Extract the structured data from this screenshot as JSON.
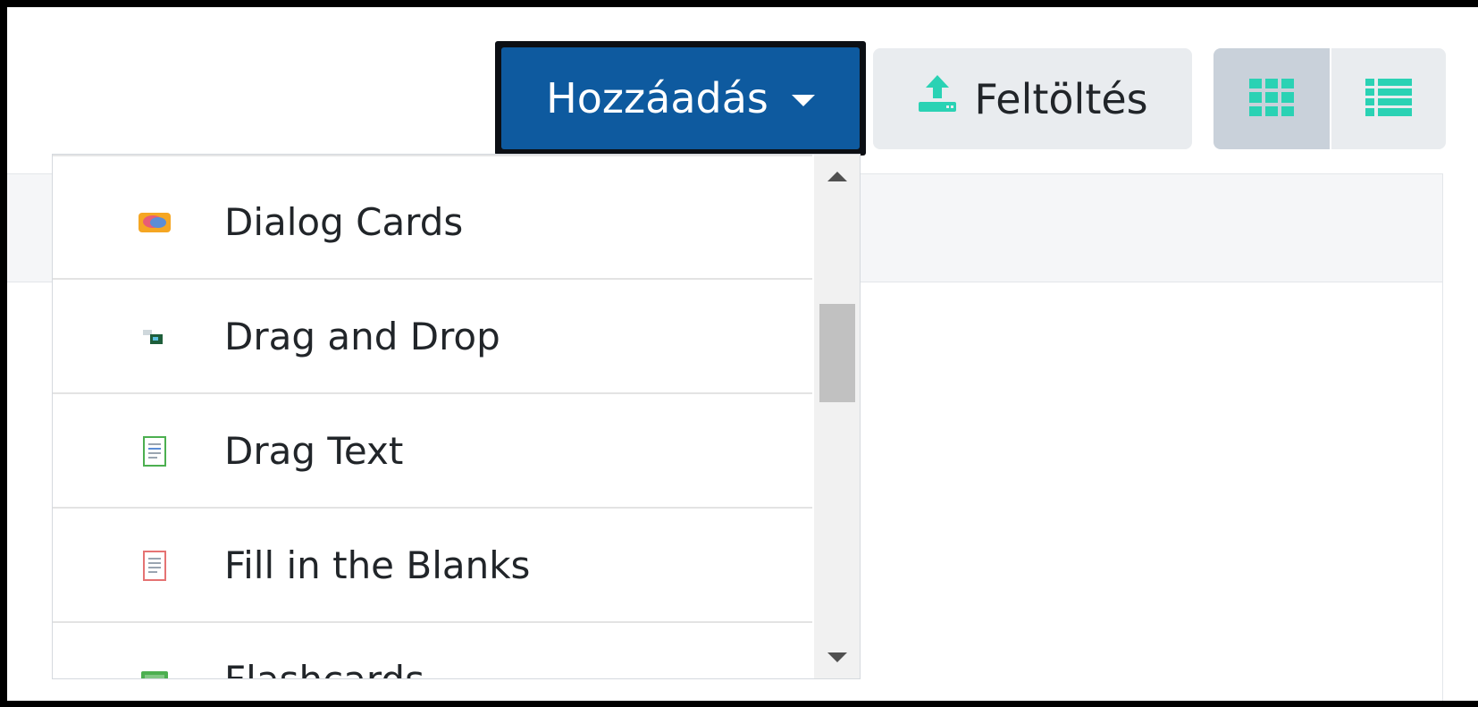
{
  "toolbar": {
    "add_label": "Hozzáadás",
    "upload_label": "Feltöltés",
    "accent_color": "#2ad2b4",
    "primary_color": "#0e5a9f"
  },
  "dropdown": {
    "items": [
      {
        "label": "Dialog Cards",
        "icon": "dialog-cards-icon"
      },
      {
        "label": "Drag and Drop",
        "icon": "drag-and-drop-icon"
      },
      {
        "label": "Drag Text",
        "icon": "drag-text-icon"
      },
      {
        "label": "Fill in the Blanks",
        "icon": "fill-in-the-blanks-icon"
      },
      {
        "label": "Flashcards",
        "icon": "flashcards-icon"
      }
    ]
  }
}
